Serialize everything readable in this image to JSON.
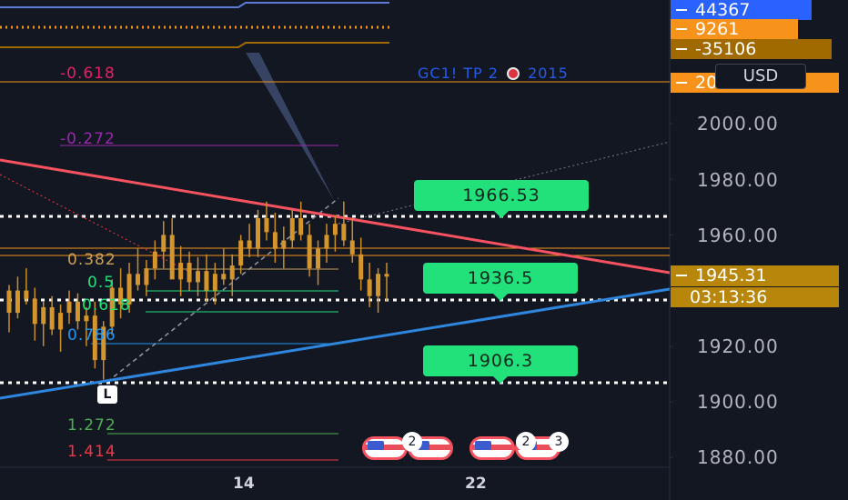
{
  "chart_data": {
    "type": "candlestick",
    "symbol_legend": "GC1! TP 2",
    "legend_year": "2015",
    "currency": "USD",
    "y_ticks": [
      "2000.00",
      "1980.00",
      "1960.00",
      "1940.00",
      "1920.00",
      "1900.00",
      "1880.00"
    ],
    "x_ticks": [
      "14",
      "22"
    ],
    "price_tags": [
      {
        "label": "44367",
        "color": "#2962ff"
      },
      {
        "label": "9261",
        "color": "#f7931a"
      },
      {
        "label": "-35106",
        "color": "#a06a00"
      },
      {
        "label": "2023.00",
        "color": "#f7931a"
      },
      {
        "label": "1945.31",
        "color": "#b8860b"
      },
      {
        "label": "03:13:36",
        "color": "#b8860b"
      }
    ],
    "fib_levels": [
      {
        "label": "-0.618",
        "value": 2015,
        "color": "#e91e63"
      },
      {
        "label": "-0.272",
        "value": 1992,
        "color": "#9c27b0"
      },
      {
        "label": "0.382",
        "value": 1950,
        "color": "#c9a15a"
      },
      {
        "label": "0.5",
        "value": 1943,
        "color": "#22e07a"
      },
      {
        "label": "0.618",
        "value": 1935,
        "color": "#22e07a"
      },
      {
        "label": "0.786",
        "value": 1921,
        "color": "#2196f3"
      },
      {
        "label": "1.272",
        "value": 1888,
        "color": "#4caf50"
      },
      {
        "label": "1.414",
        "value": 1878,
        "color": "#f23645"
      }
    ],
    "targets": [
      {
        "label": "1966.53",
        "value": 1966.53
      },
      {
        "label": "1936.5",
        "value": 1936.5
      },
      {
        "label": "1906.3",
        "value": 1906.3
      }
    ],
    "low_marker": "L",
    "events": [
      {
        "count": "2"
      },
      {
        "count": "2"
      },
      {
        "count": "3"
      }
    ],
    "candles": [
      [
        1940,
        1942,
        1925,
        1932
      ],
      [
        1932,
        1945,
        1930,
        1940
      ],
      [
        1940,
        1948,
        1935,
        1937
      ],
      [
        1937,
        1941,
        1922,
        1928
      ],
      [
        1928,
        1936,
        1920,
        1934
      ],
      [
        1934,
        1938,
        1924,
        1926
      ],
      [
        1926,
        1935,
        1918,
        1932
      ],
      [
        1932,
        1940,
        1928,
        1936
      ],
      [
        1936,
        1939,
        1926,
        1929
      ],
      [
        1929,
        1934,
        1920,
        1931
      ],
      [
        1931,
        1936,
        1912,
        1915
      ],
      [
        1915,
        1929,
        1908,
        1927
      ],
      [
        1927,
        1944,
        1924,
        1941
      ],
      [
        1941,
        1948,
        1930,
        1935
      ],
      [
        1935,
        1950,
        1932,
        1946
      ],
      [
        1946,
        1955,
        1940,
        1942
      ],
      [
        1942,
        1951,
        1938,
        1948
      ],
      [
        1948,
        1958,
        1944,
        1954
      ],
      [
        1954,
        1965,
        1948,
        1960
      ],
      [
        1960,
        1966,
        1950,
        1944
      ],
      [
        1944,
        1956,
        1938,
        1950
      ],
      [
        1950,
        1954,
        1940,
        1943
      ],
      [
        1943,
        1952,
        1938,
        1947
      ],
      [
        1947,
        1953,
        1936,
        1940
      ],
      [
        1940,
        1950,
        1935,
        1946
      ],
      [
        1946,
        1955,
        1942,
        1944
      ],
      [
        1944,
        1953,
        1938,
        1949
      ],
      [
        1949,
        1960,
        1946,
        1958
      ],
      [
        1958,
        1964,
        1952,
        1955
      ],
      [
        1955,
        1969,
        1952,
        1966
      ],
      [
        1966,
        1972,
        1958,
        1961
      ],
      [
        1961,
        1968,
        1950,
        1955
      ],
      [
        1955,
        1963,
        1948,
        1958
      ],
      [
        1958,
        1969,
        1955,
        1966
      ],
      [
        1966,
        1972,
        1958,
        1960
      ],
      [
        1960,
        1964,
        1945,
        1948
      ],
      [
        1948,
        1958,
        1942,
        1955
      ],
      [
        1955,
        1964,
        1950,
        1960
      ],
      [
        1960,
        1967,
        1954,
        1964
      ],
      [
        1964,
        1972,
        1956,
        1958
      ],
      [
        1958,
        1966,
        1950,
        1953
      ],
      [
        1953,
        1959,
        1940,
        1944
      ],
      [
        1944,
        1950,
        1934,
        1938
      ],
      [
        1938,
        1948,
        1932,
        1946
      ],
      [
        1946,
        1950,
        1936,
        1945
      ]
    ]
  }
}
